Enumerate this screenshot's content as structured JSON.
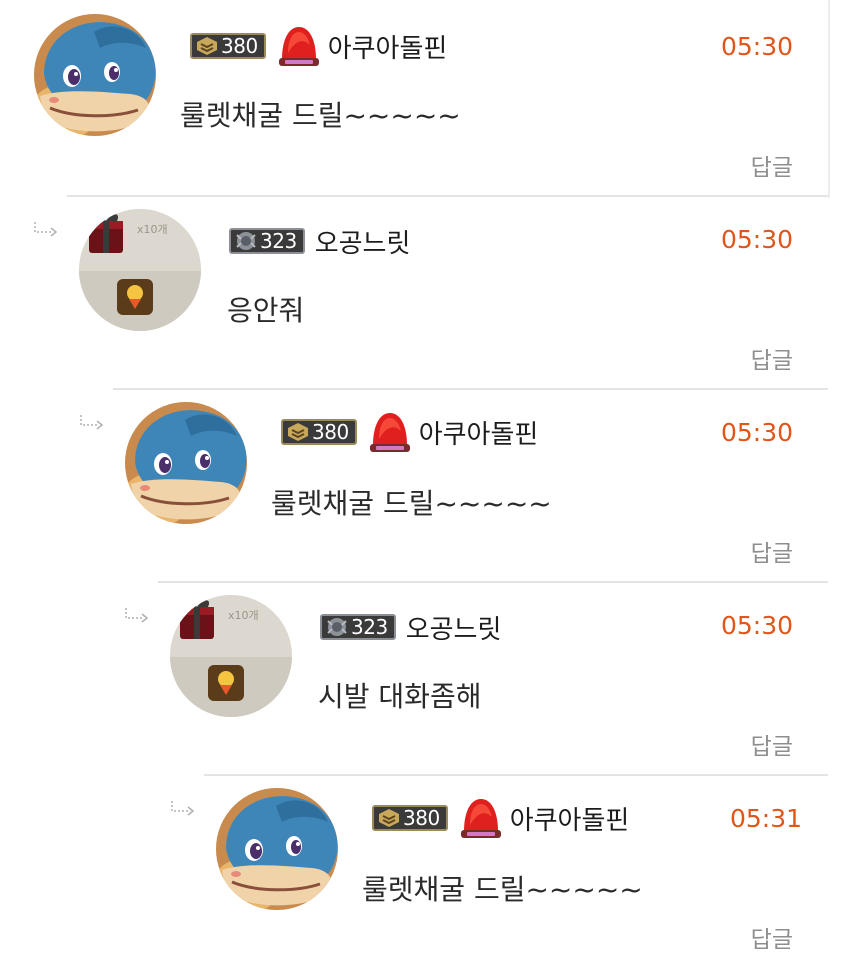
{
  "comments": [
    {
      "user": "아쿠아돌핀",
      "level": "380",
      "time": "05:30",
      "text": "룰렛채굴 드릴~~~~~",
      "reply_label": "답글",
      "avatar": "dolphin-avatar",
      "has_title_icon": true
    },
    {
      "user": "오공느릿",
      "level": "323",
      "time": "05:30",
      "text": "응안줘",
      "reply_label": "답글",
      "avatar": "gift-avatar",
      "has_title_icon": false
    },
    {
      "user": "아쿠아돌핀",
      "level": "380",
      "time": "05:30",
      "text": "룰렛채굴 드릴~~~~~",
      "reply_label": "답글",
      "avatar": "dolphin-avatar",
      "has_title_icon": true
    },
    {
      "user": "오공느릿",
      "level": "323",
      "time": "05:30",
      "text": "시발 대화좀해",
      "reply_label": "답글",
      "avatar": "gift-avatar",
      "has_title_icon": false
    },
    {
      "user": "아쿠아돌핀",
      "level": "380",
      "time": "05:31",
      "text": "룰렛채굴 드릴~~~~~",
      "reply_label": "답글",
      "avatar": "dolphin-avatar",
      "has_title_icon": true
    }
  ],
  "gift_avatar_label": "x10개",
  "colors": {
    "time": "#e0561a",
    "reply": "#8e8e8e",
    "divider": "#e3e3e3",
    "gold_badge_border": "#9b8a5a",
    "silver_badge_border": "#8c8f96",
    "title_icon_red": "#e0201e"
  },
  "icons": {
    "reply_indent": "reply-arrow-icon",
    "gold_level": "gold-level-icon",
    "silver_level": "silver-level-icon",
    "title": "red-bell-title-icon"
  }
}
